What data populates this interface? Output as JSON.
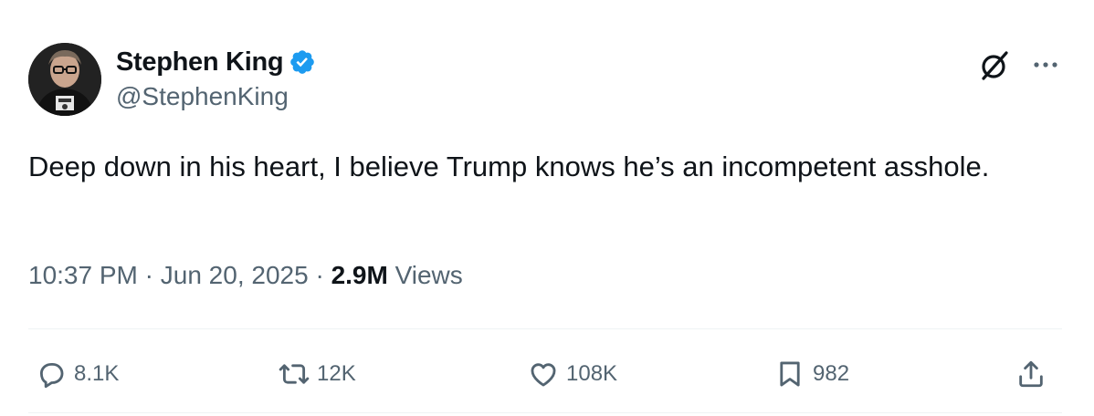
{
  "author": {
    "display_name": "Stephen King",
    "handle": "@StephenKing",
    "verified": true
  },
  "header_icons": {
    "grok": "grok-icon",
    "more": "more-options-icon"
  },
  "tweet": {
    "text": "Deep down in his heart, I believe Trump knows he’s an incompetent asshole.",
    "time": "10:37 PM",
    "date": "Jun 20, 2025",
    "separator": "·",
    "views_count": "2.9M",
    "views_label": "Views"
  },
  "actions": {
    "reply_count": "8.1K",
    "retweet_count": "12K",
    "like_count": "108K",
    "bookmark_count": "982"
  },
  "colors": {
    "text_primary": "#0f1419",
    "text_secondary": "#536471",
    "verified_blue": "#1d9bf0",
    "divider": "#eff3f4"
  }
}
